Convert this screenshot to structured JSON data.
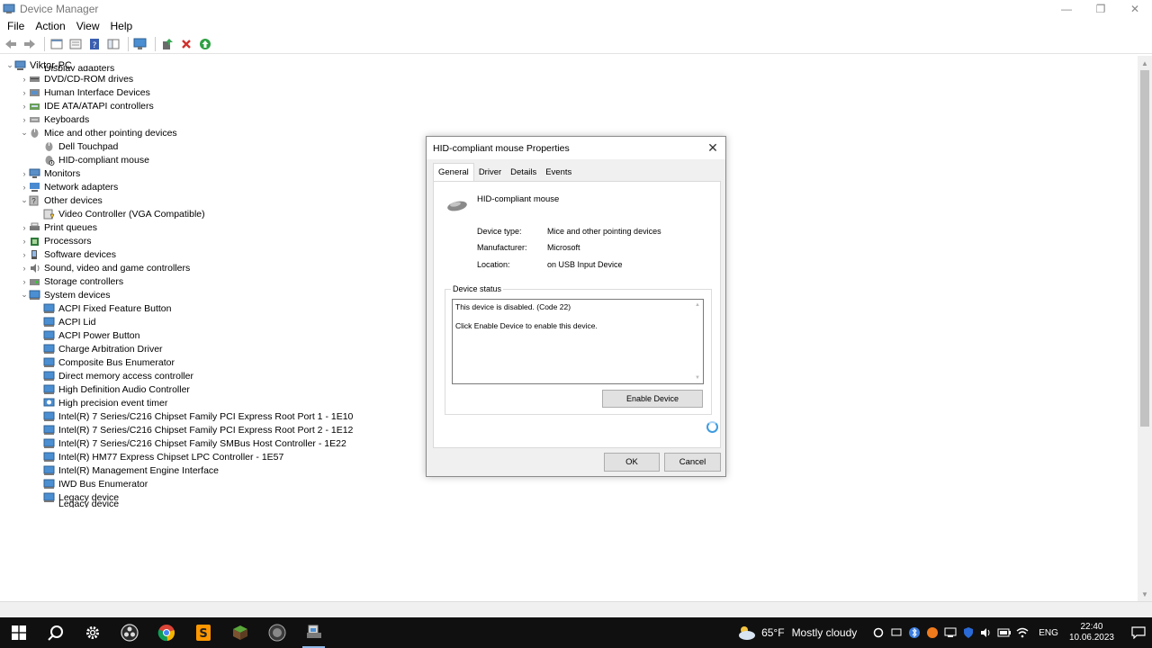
{
  "window": {
    "title": "Device Manager",
    "controls": [
      "—",
      "❐",
      "✕"
    ]
  },
  "menu": [
    "File",
    "Action",
    "View",
    "Help"
  ],
  "tree": {
    "root": "Viktor-PC",
    "partial_top": "Display adapters",
    "items": [
      {
        "label": "DVD/CD-ROM drives",
        "level": 1,
        "expander": "›",
        "icon": "dvd-icon"
      },
      {
        "label": "Human Interface Devices",
        "level": 1,
        "expander": "›",
        "icon": "hid-icon"
      },
      {
        "label": "IDE ATA/ATAPI controllers",
        "level": 1,
        "expander": "›",
        "icon": "ide-icon"
      },
      {
        "label": "Keyboards",
        "level": 1,
        "expander": "›",
        "icon": "keyboard-icon"
      },
      {
        "label": "Mice and other pointing devices",
        "level": 1,
        "expander": "⌄",
        "icon": "mouse-icon"
      },
      {
        "label": "Dell Touchpad",
        "level": 2,
        "expander": "",
        "icon": "mouse-icon"
      },
      {
        "label": "HID-compliant mouse",
        "level": 2,
        "expander": "",
        "icon": "mouse-disabled-icon"
      },
      {
        "label": "Monitors",
        "level": 1,
        "expander": "›",
        "icon": "monitor-icon"
      },
      {
        "label": "Network adapters",
        "level": 1,
        "expander": "›",
        "icon": "network-icon"
      },
      {
        "label": "Other devices",
        "level": 1,
        "expander": "⌄",
        "icon": "other-device-icon"
      },
      {
        "label": "Video Controller (VGA Compatible)",
        "level": 2,
        "expander": "",
        "icon": "unknown-device-icon"
      },
      {
        "label": "Print queues",
        "level": 1,
        "expander": "›",
        "icon": "printer-icon"
      },
      {
        "label": "Processors",
        "level": 1,
        "expander": "›",
        "icon": "processor-icon"
      },
      {
        "label": "Software devices",
        "level": 1,
        "expander": "›",
        "icon": "software-icon"
      },
      {
        "label": "Sound, video and game controllers",
        "level": 1,
        "expander": "›",
        "icon": "sound-icon"
      },
      {
        "label": "Storage controllers",
        "level": 1,
        "expander": "›",
        "icon": "storage-icon"
      },
      {
        "label": "System devices",
        "level": 1,
        "expander": "⌄",
        "icon": "system-icon"
      },
      {
        "label": "ACPI Fixed Feature Button",
        "level": 2,
        "expander": "",
        "icon": "system-icon"
      },
      {
        "label": "ACPI Lid",
        "level": 2,
        "expander": "",
        "icon": "system-icon"
      },
      {
        "label": "ACPI Power Button",
        "level": 2,
        "expander": "",
        "icon": "system-icon"
      },
      {
        "label": "Charge Arbitration Driver",
        "level": 2,
        "expander": "",
        "icon": "system-icon"
      },
      {
        "label": "Composite Bus Enumerator",
        "level": 2,
        "expander": "",
        "icon": "system-icon"
      },
      {
        "label": "Direct memory access controller",
        "level": 2,
        "expander": "",
        "icon": "system-icon"
      },
      {
        "label": "High Definition Audio Controller",
        "level": 2,
        "expander": "",
        "icon": "system-icon"
      },
      {
        "label": "High precision event timer",
        "level": 2,
        "expander": "",
        "icon": "timer-icon"
      },
      {
        "label": "Intel(R) 7 Series/C216 Chipset Family PCI Express Root Port 1 - 1E10",
        "level": 2,
        "expander": "",
        "icon": "system-icon"
      },
      {
        "label": "Intel(R) 7 Series/C216 Chipset Family PCI Express Root Port 2 - 1E12",
        "level": 2,
        "expander": "",
        "icon": "system-icon"
      },
      {
        "label": "Intel(R) 7 Series/C216 Chipset Family SMBus Host Controller - 1E22",
        "level": 2,
        "expander": "",
        "icon": "system-icon"
      },
      {
        "label": "Intel(R) HM77 Express Chipset LPC Controller - 1E57",
        "level": 2,
        "expander": "",
        "icon": "system-icon"
      },
      {
        "label": "Intel(R) Management Engine Interface",
        "level": 2,
        "expander": "",
        "icon": "system-icon"
      },
      {
        "label": "IWD Bus Enumerator",
        "level": 2,
        "expander": "",
        "icon": "system-icon"
      },
      {
        "label": "Legacy device",
        "level": 2,
        "expander": "",
        "icon": "system-icon"
      }
    ],
    "partial_bottom": "Legacy device"
  },
  "dialog": {
    "title": "HID-compliant mouse Properties",
    "close": "✕",
    "tabs": [
      "General",
      "Driver",
      "Details",
      "Events"
    ],
    "device_name": "HID-compliant mouse",
    "props": [
      {
        "label": "Device type:",
        "value": "Mice and other pointing devices"
      },
      {
        "label": "Manufacturer:",
        "value": "Microsoft"
      },
      {
        "label": "Location:",
        "value": "on USB Input Device"
      }
    ],
    "status_label": "Device status",
    "status_line1": "This device is disabled. (Code 22)",
    "status_line2": "Click Enable Device to enable this device.",
    "enable_button": "Enable Device",
    "ok": "OK",
    "cancel": "Cancel"
  },
  "taskbar": {
    "weather_temp": "65°F",
    "weather_cond": "Mostly cloudy",
    "lang": "ENG",
    "time": "22:40",
    "date": "10.06.2023"
  },
  "colors": {
    "accent": "#3d9be0",
    "taskbar": "#101010",
    "disabled_red": "#d0312d"
  }
}
